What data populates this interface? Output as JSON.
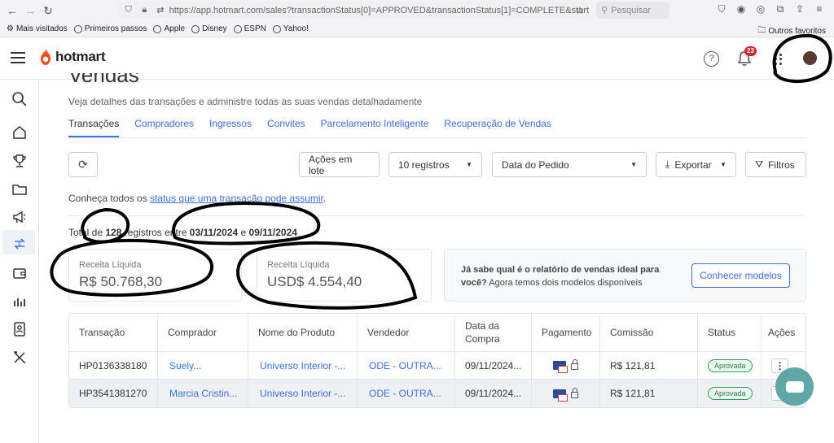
{
  "browser": {
    "url": "https://app.hotmart.com/sales?transactionStatus[0]=APPROVED&transactionStatus[1]=COMPLETE&start",
    "search_placeholder": "Pesquisar",
    "bookmarks": [
      "Mais visitados",
      "Primeiros passos",
      "Apple",
      "Disney",
      "ESPN",
      "Yahoo!"
    ],
    "other_bookmarks": "Outros favoritos"
  },
  "header": {
    "logo": "hotmart",
    "notifications_count": "23",
    "brand_color": "#f04e23"
  },
  "page": {
    "title": "Vendas",
    "subtitle": "Veja detalhes das transações e administre todas as suas vendas detalhadamente"
  },
  "tabs": [
    "Transações",
    "Compradores",
    "Ingressos",
    "Convites",
    "Parcelamento Inteligente",
    "Recuperação de Vendas"
  ],
  "toolbar": {
    "bulk_actions": "Ações em lote",
    "records": "10 registros",
    "date_filter": "Data do Pedido",
    "export": "Exportar",
    "filters": "Filtros"
  },
  "info": {
    "prefix": "Conheça todos os ",
    "link": "status que uma transação pode assumir",
    "suffix": "."
  },
  "total": {
    "prefix": "Total de ",
    "count": "128",
    "middle": " registros entre ",
    "start": "03/11/2024",
    "and": " e ",
    "end": "09/11/2024"
  },
  "cards": [
    {
      "label": "Receita Líquida",
      "value": "R$ 50.768,30"
    },
    {
      "label": "Receita Líquida",
      "value": "USD$ 4.554,40"
    }
  ],
  "promo": {
    "bold": "Já sabe qual é o relatório de vendas ideal para você?",
    "text": " Agora temos dois modelos disponíveis",
    "button": "Conhecer modelos"
  },
  "table": {
    "headers": [
      "Transação",
      "Comprador",
      "Nome do Produto",
      "Vendedor",
      "Data da Compra",
      "Pagamento",
      "Comissão",
      "Status",
      "Ações"
    ],
    "rows": [
      {
        "id": "HP0136338180",
        "buyer": "Suely...",
        "product": "Universo Interior -...",
        "seller": "ODE - OUTRA...",
        "date": "09/11/2024...",
        "commission": "R$ 121,81",
        "status": "Aprovada"
      },
      {
        "id": "HP3541381270",
        "buyer": "Marcia Cristin...",
        "product": "Universo Interior -...",
        "seller": "ODE - OUTRA...",
        "date": "09/11/2024...",
        "commission": "R$ 121,81",
        "status": "Aprovada"
      }
    ]
  },
  "colors": {
    "link": "#3d6ee0",
    "status_green": "#2e9a5d",
    "chat": "#5fa7a7"
  }
}
